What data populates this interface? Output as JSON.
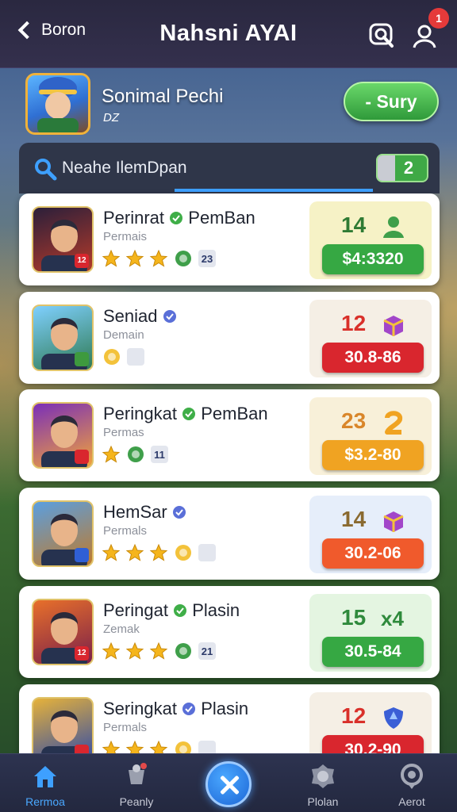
{
  "header": {
    "back_label": "Boron",
    "title": "Nahsni AYAI",
    "notification_count": "1"
  },
  "profile": {
    "name": "Sonimal Pechi",
    "subtitle": "DZ"
  },
  "sort_button": {
    "label": "- Sury"
  },
  "search": {
    "placeholder": "Neahe IlemDpan",
    "count": "2"
  },
  "colors": {
    "accent": "#3ea0ff",
    "green": "#36a843",
    "red": "#d9262e",
    "orange": "#f0a322"
  },
  "players": [
    {
      "name": "Perinrat",
      "name2": "PemBan",
      "sub": "Permais",
      "tag": "23",
      "rank": "14",
      "price": "$4:3320",
      "panel": "#f6f2c6",
      "price_color": "#36a843",
      "rank_color": "#2f7b34",
      "icon": "person-icon",
      "corner": "12",
      "corner_color": "#d9262e",
      "stars": 3
    },
    {
      "name": "Seniad",
      "name2": "",
      "sub": "Demain",
      "tag": "",
      "rank": "12",
      "price": "30.8-86",
      "panel": "#f5efe5",
      "price_color": "#d9262e",
      "rank_color": "#d9302a",
      "icon": "gift-box-icon",
      "corner": "",
      "corner_color": "#3e9a3e",
      "stars": 0
    },
    {
      "name": "Peringkat",
      "name2": "PemBan",
      "sub": "Permas",
      "tag": "11",
      "rank": "23",
      "price": "$3.2-80",
      "panel": "#f8f0d9",
      "price_color": "#f0a322",
      "rank_color": "#d9862a",
      "icon": "number-icon",
      "corner": "",
      "corner_color": "#d9262e",
      "stars": 1
    },
    {
      "name": "HemSar",
      "name2": "",
      "sub": "Permals",
      "tag": "",
      "rank": "14",
      "price": "30.2-06",
      "panel": "#e6eefa",
      "price_color": "#f05a2c",
      "rank_color": "#8a6a30",
      "icon": "gift-box-icon",
      "corner": "",
      "corner_color": "#2f5fd6",
      "stars": 3
    },
    {
      "name": "Peringat",
      "name2": "Plasin",
      "sub": "Zemak",
      "tag": "21",
      "rank": "15",
      "price": "30.5-84",
      "panel": "#e4f5e1",
      "price_color": "#36a843",
      "rank_color": "#2f8a3c",
      "icon": "x4-icon",
      "corner": "12",
      "corner_color": "#d9262e",
      "stars": 3
    },
    {
      "name": "Seringkat",
      "name2": "Plasin",
      "sub": "Permals",
      "tag": "",
      "rank": "12",
      "price": "30.2-90",
      "panel": "#f5efe5",
      "price_color": "#d9262e",
      "rank_color": "#d9302a",
      "icon": "shield-icon",
      "corner": "",
      "corner_color": "#d9262e",
      "stars": 3
    }
  ],
  "x4_text": "x4",
  "nav": [
    {
      "label": "Rermoa",
      "icon": "home-icon",
      "active": true
    },
    {
      "label": "Peanly",
      "icon": "trophy-icon",
      "active": false
    },
    {
      "label": "",
      "icon": "close-icon",
      "active": false
    },
    {
      "label": "Plolan",
      "icon": "badge-icon",
      "active": false
    },
    {
      "label": "Aerot",
      "icon": "location-icon",
      "active": false
    }
  ]
}
